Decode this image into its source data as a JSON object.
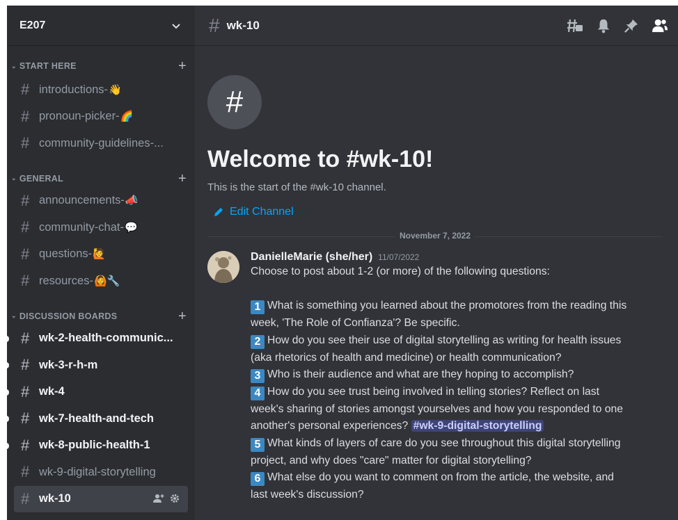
{
  "server": {
    "name": "E207"
  },
  "categories": [
    {
      "name": "START HERE",
      "channels": [
        {
          "name": "introductions-",
          "emoji": "👋",
          "unread": false
        },
        {
          "name": "pronoun-picker-",
          "emoji": "🌈",
          "unread": false
        },
        {
          "name": "community-guidelines-...",
          "emoji": "",
          "unread": false
        }
      ]
    },
    {
      "name": "GENERAL",
      "channels": [
        {
          "name": "announcements-",
          "emoji": "📣",
          "unread": false
        },
        {
          "name": "community-chat-",
          "emoji": "💬",
          "unread": false
        },
        {
          "name": "questions-",
          "emoji": "🙋",
          "unread": false
        },
        {
          "name": "resources-",
          "emoji": "🙆🔧",
          "unread": false
        }
      ]
    },
    {
      "name": "DISCUSSION BOARDS",
      "channels": [
        {
          "name": "wk-2-health-communic...",
          "emoji": "",
          "unread": true
        },
        {
          "name": "wk-3-r-h-m",
          "emoji": "",
          "unread": true
        },
        {
          "name": "wk-4",
          "emoji": "",
          "unread": true
        },
        {
          "name": "wk-7-health-and-tech",
          "emoji": "",
          "unread": true
        },
        {
          "name": "wk-8-public-health-1",
          "emoji": "",
          "unread": true
        },
        {
          "name": "wk-9-digital-storytelling",
          "emoji": "",
          "unread": false
        },
        {
          "name": "wk-10",
          "emoji": "",
          "unread": false,
          "selected": true
        }
      ]
    }
  ],
  "channel": {
    "title": "wk-10"
  },
  "welcome": {
    "hash": "#",
    "title": "Welcome to #wk-10!",
    "subtitle": "This is the start of the #wk-10 channel.",
    "edit_label": "Edit Channel"
  },
  "date_divider": "November 7, 2022",
  "message": {
    "author": "DanielleMarie (she/her)",
    "timestamp": "11/07/2022",
    "intro": "Choose to post about 1-2 (or more) of the following questions:",
    "q1_num": "1",
    "q1": "What is something you learned about the promotores from the reading this week, 'The Role of Confianza'? Be specific.",
    "q2_num": "2",
    "q2": "How do you see their use of digital storytelling as writing for health issues (aka rhetorics of health and medicine) or health communication?",
    "q3_num": "3",
    "q3": "Who is their audience and what are they hoping to accomplish?",
    "q4_num": "4",
    "q4": "How do you see trust being involved in telling stories? Reflect on last week's sharing of stories amongst yourselves and how you responded to one another's personal experiences?",
    "q4_mention": "#wk-9-digital-storytelling",
    "q5_num": "5",
    "q5": "What kinds of layers of care do you see throughout this digital storytelling project, and why does \"care\" matter for digital storytelling?",
    "q6_num": "6",
    "q6": "What else do you want to comment on from the article, the website, and last week's discussion?"
  }
}
